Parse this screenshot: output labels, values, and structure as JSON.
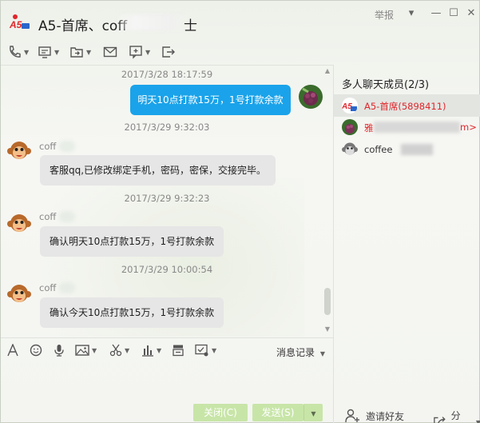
{
  "window": {
    "title_prefix": "A5-首席、coff",
    "title_suffix": "士",
    "report_label": "举报",
    "controls": [
      "▾",
      "—",
      "☐",
      "✕"
    ]
  },
  "toolbar": {
    "items": [
      "phone-icon",
      "screen-share-icon",
      "file-transfer-icon",
      "email-icon",
      "add-app-icon",
      "remote-icon"
    ]
  },
  "chat": {
    "messages": [
      {
        "time": "2017/3/28 18:17:59",
        "sender": "",
        "text": "明天10点打款15万，1号打款余款",
        "mine": true
      },
      {
        "time": "2017/3/29 9:32:03",
        "sender": "coff",
        "text": "客服qq,已修改绑定手机，密码，密保，交接完毕。",
        "mine": false
      },
      {
        "time": "2017/3/29 9:32:23",
        "sender": "coff",
        "text": "确认明天10点打款15万，1号打款余款",
        "mine": false
      },
      {
        "time": "2017/3/29 10:00:54",
        "sender": "coff",
        "text": "确认今天10点打款15万，1号打款余款",
        "mine": false
      }
    ]
  },
  "input_toolbar": {
    "items": [
      "font-icon",
      "emoji-icon",
      "voice-icon",
      "image-icon",
      "screenshot-icon",
      "chart-icon",
      "stamp-icon",
      "shake-icon"
    ],
    "history_label": "消息记录"
  },
  "actions": {
    "close_label": "关闭(C)",
    "send_label": "发送(S)"
  },
  "members": {
    "title": "多人聊天成员(2/3)",
    "list": [
      {
        "name": "A5-首席(5898411)",
        "color": "#e0262b"
      },
      {
        "name": "雅",
        "suffix": "m>",
        "color": "#e0262b"
      },
      {
        "name": "coffee",
        "color": "#1f1f1f"
      }
    ],
    "invite_label": "邀请好友",
    "share_label": "分享"
  },
  "colors": {
    "my_bubble": "#1aa3ea",
    "other_bubble": "#e6e6e6",
    "member_highlight": "#e0262b",
    "button_green": "#c8e5a8"
  }
}
